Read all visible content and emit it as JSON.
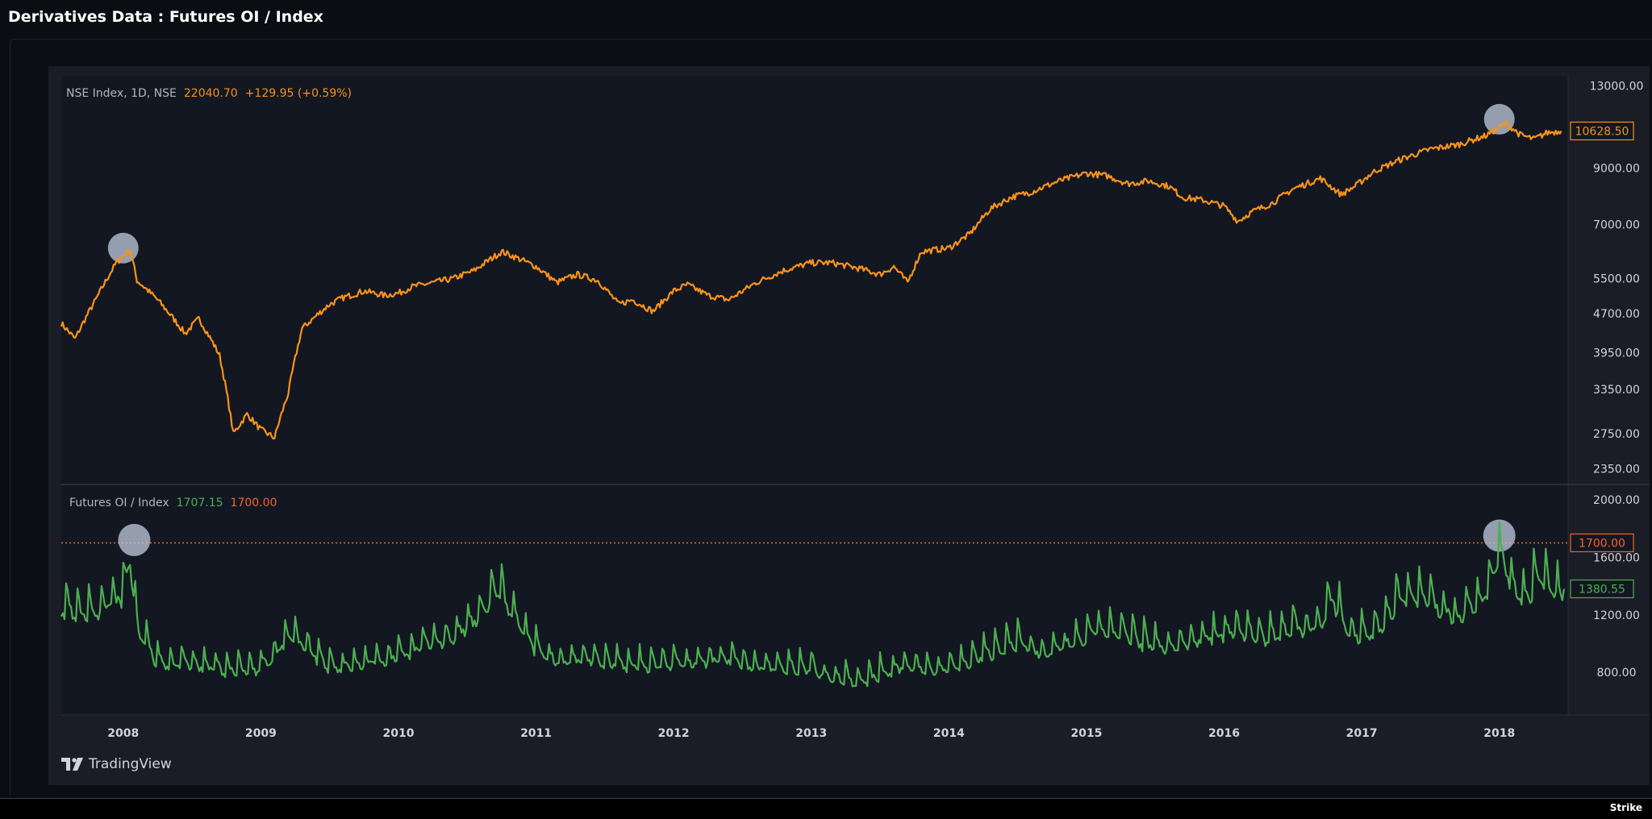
{
  "page": {
    "title": "Derivatives Data : Futures OI / Index",
    "brand": "TradingView",
    "footer_brand": "Strike"
  },
  "colors": {
    "index_line": "#f7931a",
    "ratio_line": "#4caf50",
    "ref_line": "#f0652a",
    "highlight": "#c8d2e6",
    "axis_text": "#d1d4dc",
    "legend_text": "#b2b5be"
  },
  "chart_data": [
    {
      "type": "line",
      "legend": {
        "name": "NSE Index, 1D, NSE",
        "value": "22040.70",
        "change": "+129.95 (+0.59%)"
      },
      "scale": "log",
      "ylim": [
        2200,
        13600
      ],
      "xlim": [
        2007.55,
        2018.5
      ],
      "yticks": [
        "13000.00",
        "9000.00",
        "7000.00",
        "5500.00",
        "4700.00",
        "3950.00",
        "3350.00",
        "2750.00",
        "2350.00"
      ],
      "last_value_label": "10628.50",
      "series": [
        {
          "x": [
            2007.55,
            2007.65,
            2007.8,
            2007.95,
            2008.05,
            2008.1,
            2008.25,
            2008.45,
            2008.55,
            2008.7,
            2008.8,
            2008.9,
            2009.0,
            2009.1,
            2009.2,
            2009.3,
            2009.4,
            2009.5,
            2009.6,
            2009.75,
            2009.9,
            2010.0,
            2010.1,
            2010.25,
            2010.4,
            2010.55,
            2010.75,
            2010.85,
            2011.0,
            2011.15,
            2011.3,
            2011.45,
            2011.6,
            2011.7,
            2011.85,
            2012.0,
            2012.1,
            2012.25,
            2012.4,
            2012.6,
            2012.8,
            2013.0,
            2013.15,
            2013.35,
            2013.5,
            2013.6,
            2013.7,
            2013.8,
            2014.0,
            2014.15,
            2014.3,
            2014.45,
            2014.6,
            2014.8,
            2015.0,
            2015.15,
            2015.3,
            2015.45,
            2015.6,
            2015.7,
            2015.85,
            2016.0,
            2016.1,
            2016.2,
            2016.35,
            2016.5,
            2016.7,
            2016.85,
            2016.95,
            2017.1,
            2017.3,
            2017.5,
            2017.7,
            2017.9,
            2018.05,
            2018.15,
            2018.25,
            2018.35,
            2018.45
          ],
          "values": [
            4500,
            4200,
            5000,
            5900,
            6250,
            5450,
            5000,
            4300,
            4600,
            3900,
            2750,
            3000,
            2800,
            2700,
            3300,
            4400,
            4650,
            4900,
            5050,
            5200,
            5100,
            5150,
            5300,
            5400,
            5500,
            5700,
            6200,
            6050,
            5800,
            5400,
            5600,
            5450,
            4900,
            5000,
            4750,
            5200,
            5350,
            5100,
            5000,
            5400,
            5700,
            5900,
            5900,
            5750,
            5600,
            5800,
            5400,
            6200,
            6300,
            6700,
            7500,
            7900,
            8100,
            8500,
            8800,
            8700,
            8400,
            8500,
            8300,
            7900,
            7800,
            7600,
            7100,
            7400,
            7700,
            8200,
            8600,
            8000,
            8300,
            8900,
            9400,
            9800,
            10000,
            10400,
            11000,
            10450,
            10250,
            10550,
            10628.5
          ]
        }
      ],
      "highlights": [
        {
          "x": 2008.0,
          "y": 6300
        },
        {
          "x": 2018.0,
          "y": 11200
        }
      ]
    },
    {
      "type": "line",
      "legend": {
        "name": "Futures OI / Index",
        "value": "1707.15",
        "reference": "1700.00"
      },
      "ylim": [
        510,
        2100
      ],
      "xlim": [
        2007.55,
        2018.5
      ],
      "yticks": [
        "2000.00",
        "1600.00",
        "1200.00",
        "800.00"
      ],
      "reference_line": 1700,
      "reference_label": "1700.00",
      "last_value_label": "1380.55",
      "series": [
        {
          "x": [
            2007.55,
            2007.75,
            2007.9,
            2008.0,
            2008.05,
            2008.1,
            2008.25,
            2008.4,
            2008.6,
            2008.8,
            2009.0,
            2009.2,
            2009.35,
            2009.5,
            2009.7,
            2009.9,
            2010.0,
            2010.2,
            2010.4,
            2010.6,
            2010.7,
            2010.8,
            2010.9,
            2011.0,
            2011.2,
            2011.4,
            2011.6,
            2011.8,
            2012.0,
            2012.2,
            2012.4,
            2012.6,
            2012.8,
            2013.0,
            2013.2,
            2013.35,
            2013.5,
            2013.7,
            2013.9,
            2014.1,
            2014.3,
            2014.5,
            2014.7,
            2014.9,
            2015.1,
            2015.3,
            2015.5,
            2015.7,
            2015.9,
            2016.1,
            2016.3,
            2016.5,
            2016.7,
            2016.8,
            2016.9,
            2017.0,
            2017.15,
            2017.3,
            2017.5,
            2017.7,
            2017.9,
            2018.0,
            2018.1,
            2018.2,
            2018.3,
            2018.4,
            2018.47
          ],
          "values": [
            1300,
            1250,
            1350,
            1400,
            1680,
            1150,
            900,
            920,
            880,
            850,
            860,
            1100,
            1000,
            880,
            900,
            940,
            960,
            1050,
            1100,
            1250,
            1450,
            1300,
            1150,
            1000,
            920,
            940,
            900,
            880,
            900,
            920,
            950,
            870,
            880,
            860,
            800,
            760,
            820,
            900,
            860,
            900,
            980,
            1050,
            980,
            1050,
            1150,
            1100,
            1020,
            1060,
            1100,
            1150,
            1080,
            1150,
            1200,
            1350,
            1150,
            1100,
            1200,
            1400,
            1350,
            1250,
            1400,
            1690,
            1450,
            1400,
            1500,
            1450,
            1380.55
          ]
        }
      ],
      "highlights": [
        {
          "x": 2008.08,
          "y": 1720
        },
        {
          "x": 2018.0,
          "y": 1750
        }
      ]
    }
  ],
  "time_axis": {
    "labels": [
      "2008",
      "2009",
      "2010",
      "2011",
      "2012",
      "2013",
      "2014",
      "2015",
      "2016",
      "2017",
      "2018"
    ],
    "positions": [
      2008,
      2009,
      2010,
      2011,
      2012,
      2013,
      2014,
      2015,
      2016,
      2017,
      2018
    ]
  }
}
